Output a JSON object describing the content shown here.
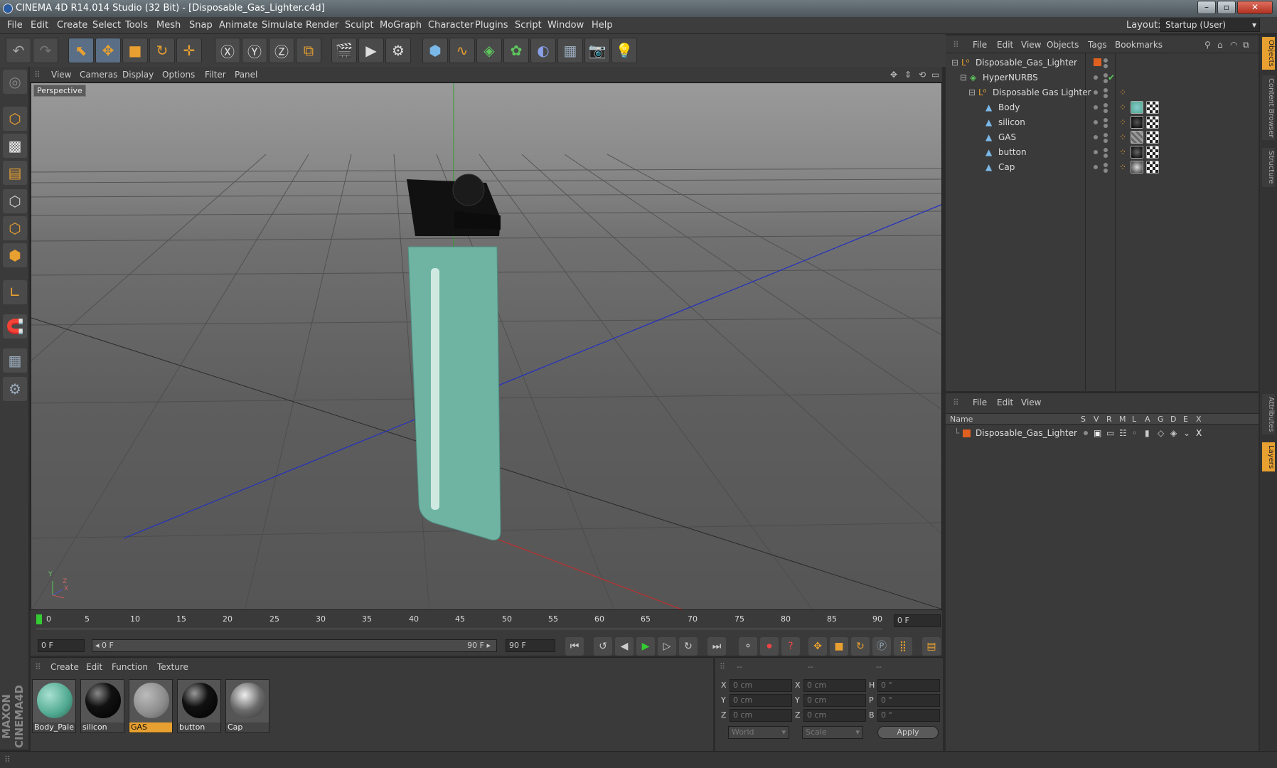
{
  "window": {
    "title": "CINEMA 4D R14.014 Studio (32 Bit) - [Disposable_Gas_Lighter.c4d]"
  },
  "menubar": {
    "items": [
      "File",
      "Edit",
      "Create",
      "Select",
      "Tools",
      "Mesh",
      "Snap",
      "Animate",
      "Simulate",
      "Render",
      "Sculpt",
      "MoGraph",
      "Character",
      "Plugins",
      "Script",
      "Window",
      "Help"
    ],
    "layout_label": "Layout:",
    "layout_value": "Startup (User)"
  },
  "viewport": {
    "menus": [
      "View",
      "Cameras",
      "Display",
      "Options",
      "Filter",
      "Panel"
    ],
    "label": "Perspective",
    "axis_y": "Y",
    "axis_z": "Z",
    "axis_x": "X"
  },
  "timeline": {
    "ticks": [
      "0",
      "5",
      "10",
      "15",
      "20",
      "25",
      "30",
      "35",
      "40",
      "45",
      "50",
      "55",
      "60",
      "65",
      "70",
      "75",
      "80",
      "85",
      "90"
    ],
    "frame_right": "0 F"
  },
  "transport": {
    "start": "0 F",
    "range_left": "◂ 0 F",
    "range_right": "90 F ▸",
    "end": "90 F"
  },
  "materials": {
    "menus": [
      "Create",
      "Edit",
      "Function",
      "Texture"
    ],
    "items": [
      {
        "name": "Body_Pale",
        "color": "#4fa890"
      },
      {
        "name": "silicon",
        "color": "#111111"
      },
      {
        "name": "GAS",
        "color": "#8a8a8a"
      },
      {
        "name": "button",
        "color": "#111111"
      },
      {
        "name": "Cap",
        "color": "#6a6a6a"
      }
    ]
  },
  "coords": {
    "headers": [
      "--",
      "--",
      "--"
    ],
    "row_labels": [
      "X",
      "Y",
      "Z"
    ],
    "mid_labels": [
      "X",
      "Y",
      "Z"
    ],
    "right_labels": [
      "H",
      "P",
      "B"
    ],
    "pos": [
      "0 cm",
      "0 cm",
      "0 cm"
    ],
    "size": [
      "0 cm",
      "0 cm",
      "0 cm"
    ],
    "rot": [
      "0 °",
      "0 °",
      "0 °"
    ],
    "world": "World",
    "scale": "Scale",
    "apply": "Apply"
  },
  "objects": {
    "menus": [
      "File",
      "Edit",
      "View",
      "Objects",
      "Tags",
      "Bookmarks"
    ],
    "tree": [
      "Disposable_Gas_Lighter",
      "HyperNURBS",
      "Disposable Gas Lighter",
      "Body",
      "silicon",
      "GAS",
      "button",
      "Cap"
    ]
  },
  "layers": {
    "menus": [
      "File",
      "Edit",
      "View"
    ],
    "col_name": "Name",
    "cols": [
      "S",
      "V",
      "R",
      "M",
      "L",
      "A",
      "G",
      "D",
      "E",
      "X"
    ],
    "row": "Disposable_Gas_Lighter"
  },
  "side_tabs": [
    "Objects",
    "Content Browser",
    "Structure",
    "Attributes",
    "Layers"
  ],
  "brand": "MAXON CINEMA4D"
}
